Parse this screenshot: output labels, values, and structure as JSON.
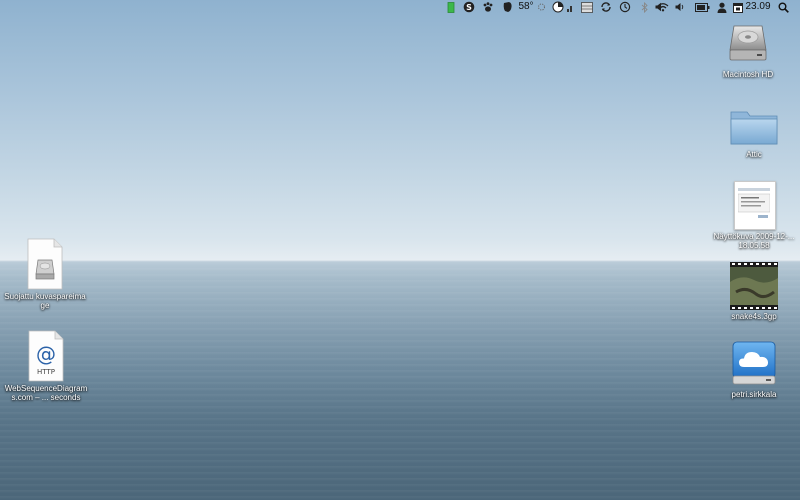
{
  "menubar": {
    "temperature": "58°",
    "clock": "23.09"
  },
  "desktop_icons": [
    {
      "label": "Macintosh HD",
      "kind": "hard-drive"
    },
    {
      "label": "Attic",
      "kind": "folder"
    },
    {
      "label": "Näyttökuva 2009-12-... 18.05.58",
      "kind": "screenshot-document"
    },
    {
      "label": "snake4s.3gp",
      "kind": "video-file"
    },
    {
      "label": "petri.sirkkala",
      "kind": "cloud-drive"
    },
    {
      "label": "Suojattu kuvaspareimage",
      "kind": "disk-image"
    },
    {
      "label": "WebSequenceDiagrams.com – ... seconds",
      "kind": "webloc"
    }
  ],
  "colors": {
    "sky_top": "#8fb2cf",
    "horizon": "#e6edf2",
    "sea_bottom": "#4b6679",
    "battery_green": "#3cb84a"
  }
}
